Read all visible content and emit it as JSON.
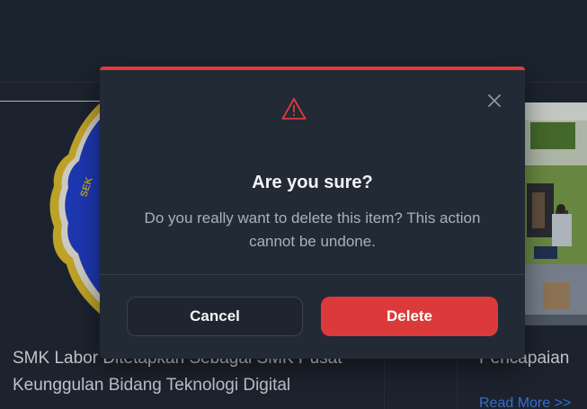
{
  "background": {
    "left_card_title": "SMK Labor Ditetapkan Sebagai SMK Pusat Keunggulan Bidang Teknologi Digital",
    "right_card_title": "Pencapaian",
    "right_card_link": "Read More >>",
    "logo_text": "SEK"
  },
  "modal": {
    "title": "Are you sure?",
    "message": "Do you really want to delete this item? This action cannot be undone.",
    "cancel_label": "Cancel",
    "delete_label": "Delete",
    "icons": {
      "warning": "warning-triangle-icon",
      "close": "close-icon"
    },
    "colors": {
      "accent": "#e03b3b",
      "delete_button": "#dc3a3a"
    }
  }
}
